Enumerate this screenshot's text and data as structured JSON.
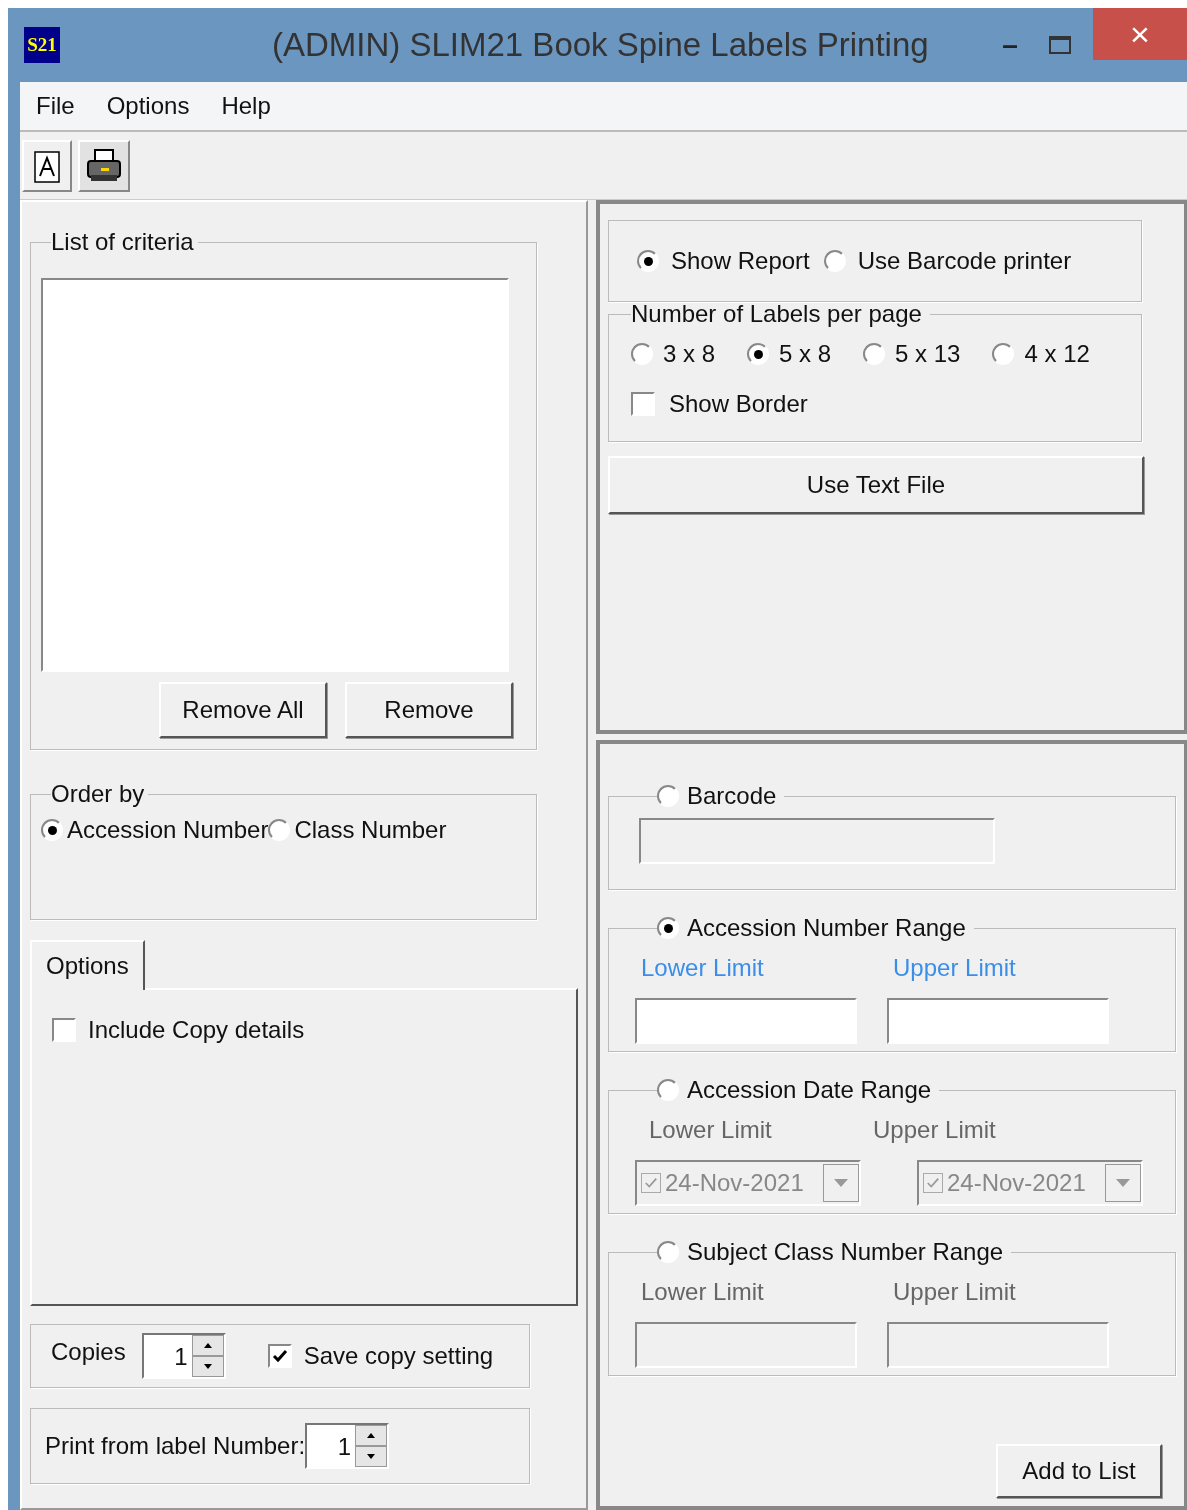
{
  "window": {
    "title": "(ADMIN) SLIM21 Book Spine Labels Printing",
    "logo": "S21",
    "minimize": "–",
    "close": "×"
  },
  "menu": [
    "File",
    "Options",
    "Help"
  ],
  "list_of_criteria": {
    "title": "List of criteria",
    "buttons": [
      "Remove All",
      "Remove"
    ]
  },
  "order_by": {
    "title": "Order by",
    "options": [
      {
        "label": "Accession Number",
        "selected": true
      },
      {
        "label": "Class Number",
        "selected": false
      }
    ]
  },
  "options_tab": {
    "label": "Options",
    "selected": true,
    "include_copy": {
      "label": "Include Copy details",
      "checked": false
    }
  },
  "copies": {
    "label": "Copies",
    "value": "1",
    "save": {
      "label": "Save copy setting",
      "checked": true
    }
  },
  "print_from": {
    "label": "Print from label Number:",
    "value": "1"
  },
  "report_mode": [
    {
      "label": "Show Report",
      "selected": true
    },
    {
      "label": "Use Barcode printer",
      "selected": false
    }
  ],
  "labels_per_page": {
    "title": "Number of Labels per page",
    "options": [
      {
        "label": "3 x 8",
        "selected": false
      },
      {
        "label": "5 x 8",
        "selected": true
      },
      {
        "label": "5 x 13",
        "selected": false
      },
      {
        "label": "4 x 12",
        "selected": false
      }
    ],
    "show_border": {
      "label": "Show Border",
      "checked": false
    }
  },
  "use_text_file": "Use Text File",
  "criteria": [
    {
      "kind": "single",
      "label": "Barcode",
      "selected": false
    },
    {
      "kind": "text",
      "label": "Accession Number Range",
      "selected": true,
      "lower": "Lower Limit",
      "upper": "Upper Limit"
    },
    {
      "kind": "date",
      "label": "Accession Date Range",
      "selected": false,
      "lower": "Lower Limit",
      "upper": "Upper Limit",
      "lower_value": "24-Nov-2021",
      "upper_value": "24-Nov-2021",
      "lower_checked": true,
      "upper_checked": true
    },
    {
      "kind": "text",
      "label": "Subject Class Number Range",
      "selected": false,
      "lower": "Lower Limit",
      "upper": "Upper Limit"
    }
  ],
  "add_button": "Add to List"
}
